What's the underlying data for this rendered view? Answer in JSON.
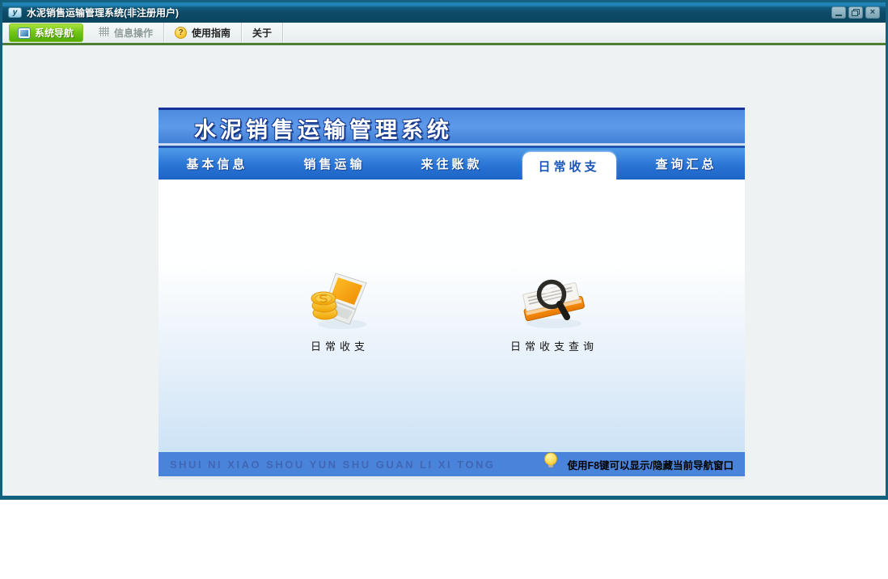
{
  "window": {
    "title": "水泥销售运输管理系统(非注册用户)",
    "app_icon": "y",
    "controls": {
      "minimize": "minimize",
      "restore": "restore",
      "close": "×"
    }
  },
  "toolbar": {
    "items": [
      {
        "label": "系统导航",
        "icon": "monitor-icon",
        "state": "active"
      },
      {
        "label": "信息操作",
        "icon": "grid-icon",
        "state": "disabled"
      },
      {
        "label": "使用指南",
        "icon": "help-icon",
        "state": "normal"
      },
      {
        "label": "关于",
        "icon": "",
        "state": "normal"
      }
    ],
    "help_icon_glyph": "?"
  },
  "panel": {
    "banner_title": "水泥销售运输管理系统",
    "tabs": [
      {
        "label": "基本信息",
        "active": false
      },
      {
        "label": "销售运输",
        "active": false
      },
      {
        "label": "来往账款",
        "active": false
      },
      {
        "label": "日常收支",
        "active": true
      },
      {
        "label": "查询汇总",
        "active": false
      }
    ],
    "shortcuts": [
      {
        "label": "日常收支",
        "icon": "laptop-coins-icon"
      },
      {
        "label": "日常收支查询",
        "icon": "book-magnifier-icon"
      }
    ],
    "footer": {
      "watermark": "SHUI NI XIAO SHOU YUN SHU GUAN LI XI TONG",
      "hint": "使用F8键可以显示/隐藏当前导航窗口",
      "hint_icon": "lightbulb-icon"
    }
  },
  "colors": {
    "window_border": "#14607f",
    "titlebar": "#0d4a66",
    "toolbar_active_green": "#74c717",
    "toolbar_underline_green": "#4d7e31",
    "banner_blue": "#5e9ae9",
    "tabbar_blue": "#2a74d4",
    "active_tab_text": "#1956ba",
    "content_fade_blue": "#cde3f6",
    "footer_blue": "#4a84da",
    "watermark_text": "#4166b4"
  }
}
